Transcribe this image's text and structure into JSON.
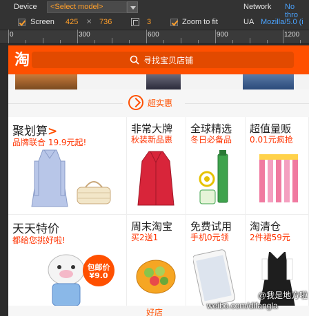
{
  "devtools": {
    "device_label": "Device",
    "device_select": "<Select model>",
    "network_label": "Network",
    "network_select": "No thro",
    "screen_label": "Screen",
    "screen_width": "425",
    "screen_times": "×",
    "screen_height": "736",
    "scale_value": "3",
    "zoom_label": "Zoom to fit",
    "ua_label": "UA",
    "ua_value": "Mozilla/5.0 (i",
    "accent_color": "#ff9f2a"
  },
  "ruler": {
    "labels": [
      "0",
      "300",
      "600",
      "900",
      "1200"
    ]
  },
  "page": {
    "brand_color": "#ff5000",
    "logo_text": "淘",
    "search_placeholder": "寻找宝贝店铺",
    "section_title": "超实惠",
    "cells": [
      {
        "title": "聚划算",
        "arrow": ">",
        "sub": "品牌联合  19.9元起!"
      },
      {
        "title": "非常大牌",
        "sub": "秋装新品惠"
      },
      {
        "title": "全球精选",
        "sub": "冬日必备品"
      },
      {
        "title": "超值量贩",
        "sub": "0.01元疯抢"
      },
      {
        "title": "天天特价",
        "sub": "都给您挑好啦!"
      },
      {
        "title": "周末淘宝",
        "sub": "买2送1"
      },
      {
        "title": "免费试用",
        "sub": "手机0元领"
      },
      {
        "title": "淘清仓",
        "sub": "2件裙59元"
      }
    ],
    "badge_line1": "包邮价",
    "badge_line2": "¥9.0",
    "next_section_partial": "好店"
  },
  "watermark": {
    "line1": "@我是地方啦",
    "line2": "weibo.com/difangla"
  }
}
